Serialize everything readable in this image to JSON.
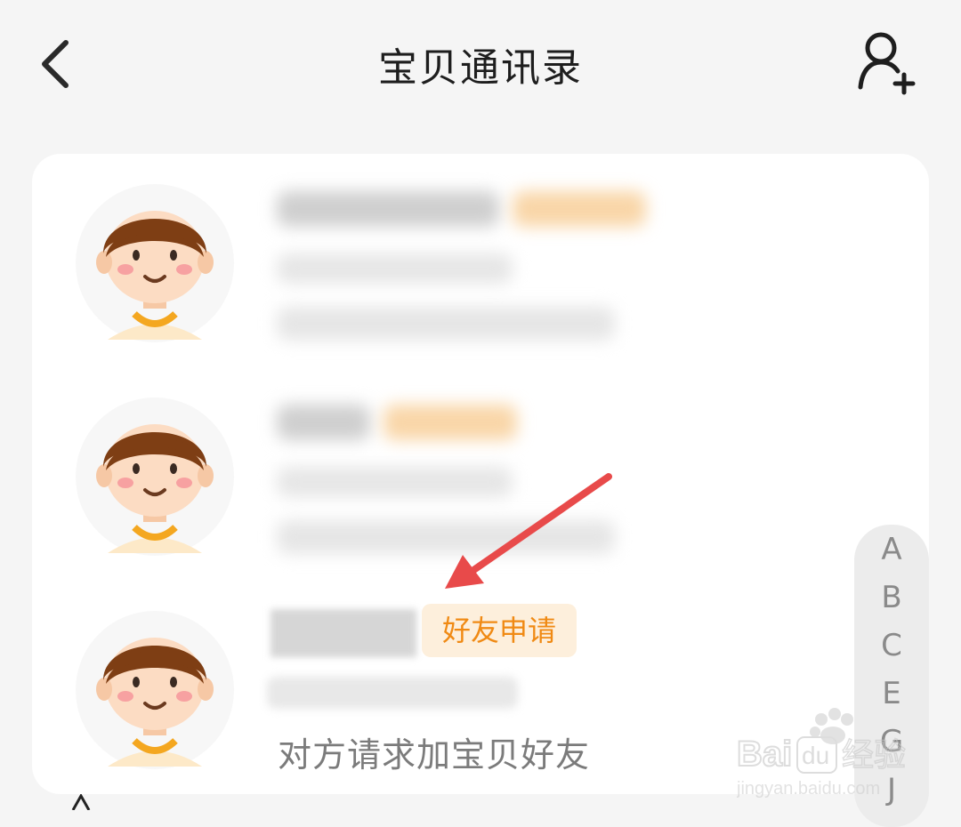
{
  "header": {
    "title": "宝贝通讯录",
    "back_icon": "chevron-left-icon",
    "add_icon": "add-user-icon"
  },
  "contacts": [
    {
      "status": "blurred"
    },
    {
      "status": "blurred"
    },
    {
      "badge": "好友申请",
      "description": "对方请求加宝贝好友"
    }
  ],
  "index_bar": {
    "letters": [
      "A",
      "B",
      "C",
      "E",
      "G",
      "J"
    ]
  },
  "colors": {
    "accent": "#f08a14",
    "badge_bg": "#fdefdc",
    "annotation_arrow": "#e84a4a"
  },
  "watermark": {
    "brand": "Baidu经验",
    "url": "jingyan.baidu.com"
  }
}
